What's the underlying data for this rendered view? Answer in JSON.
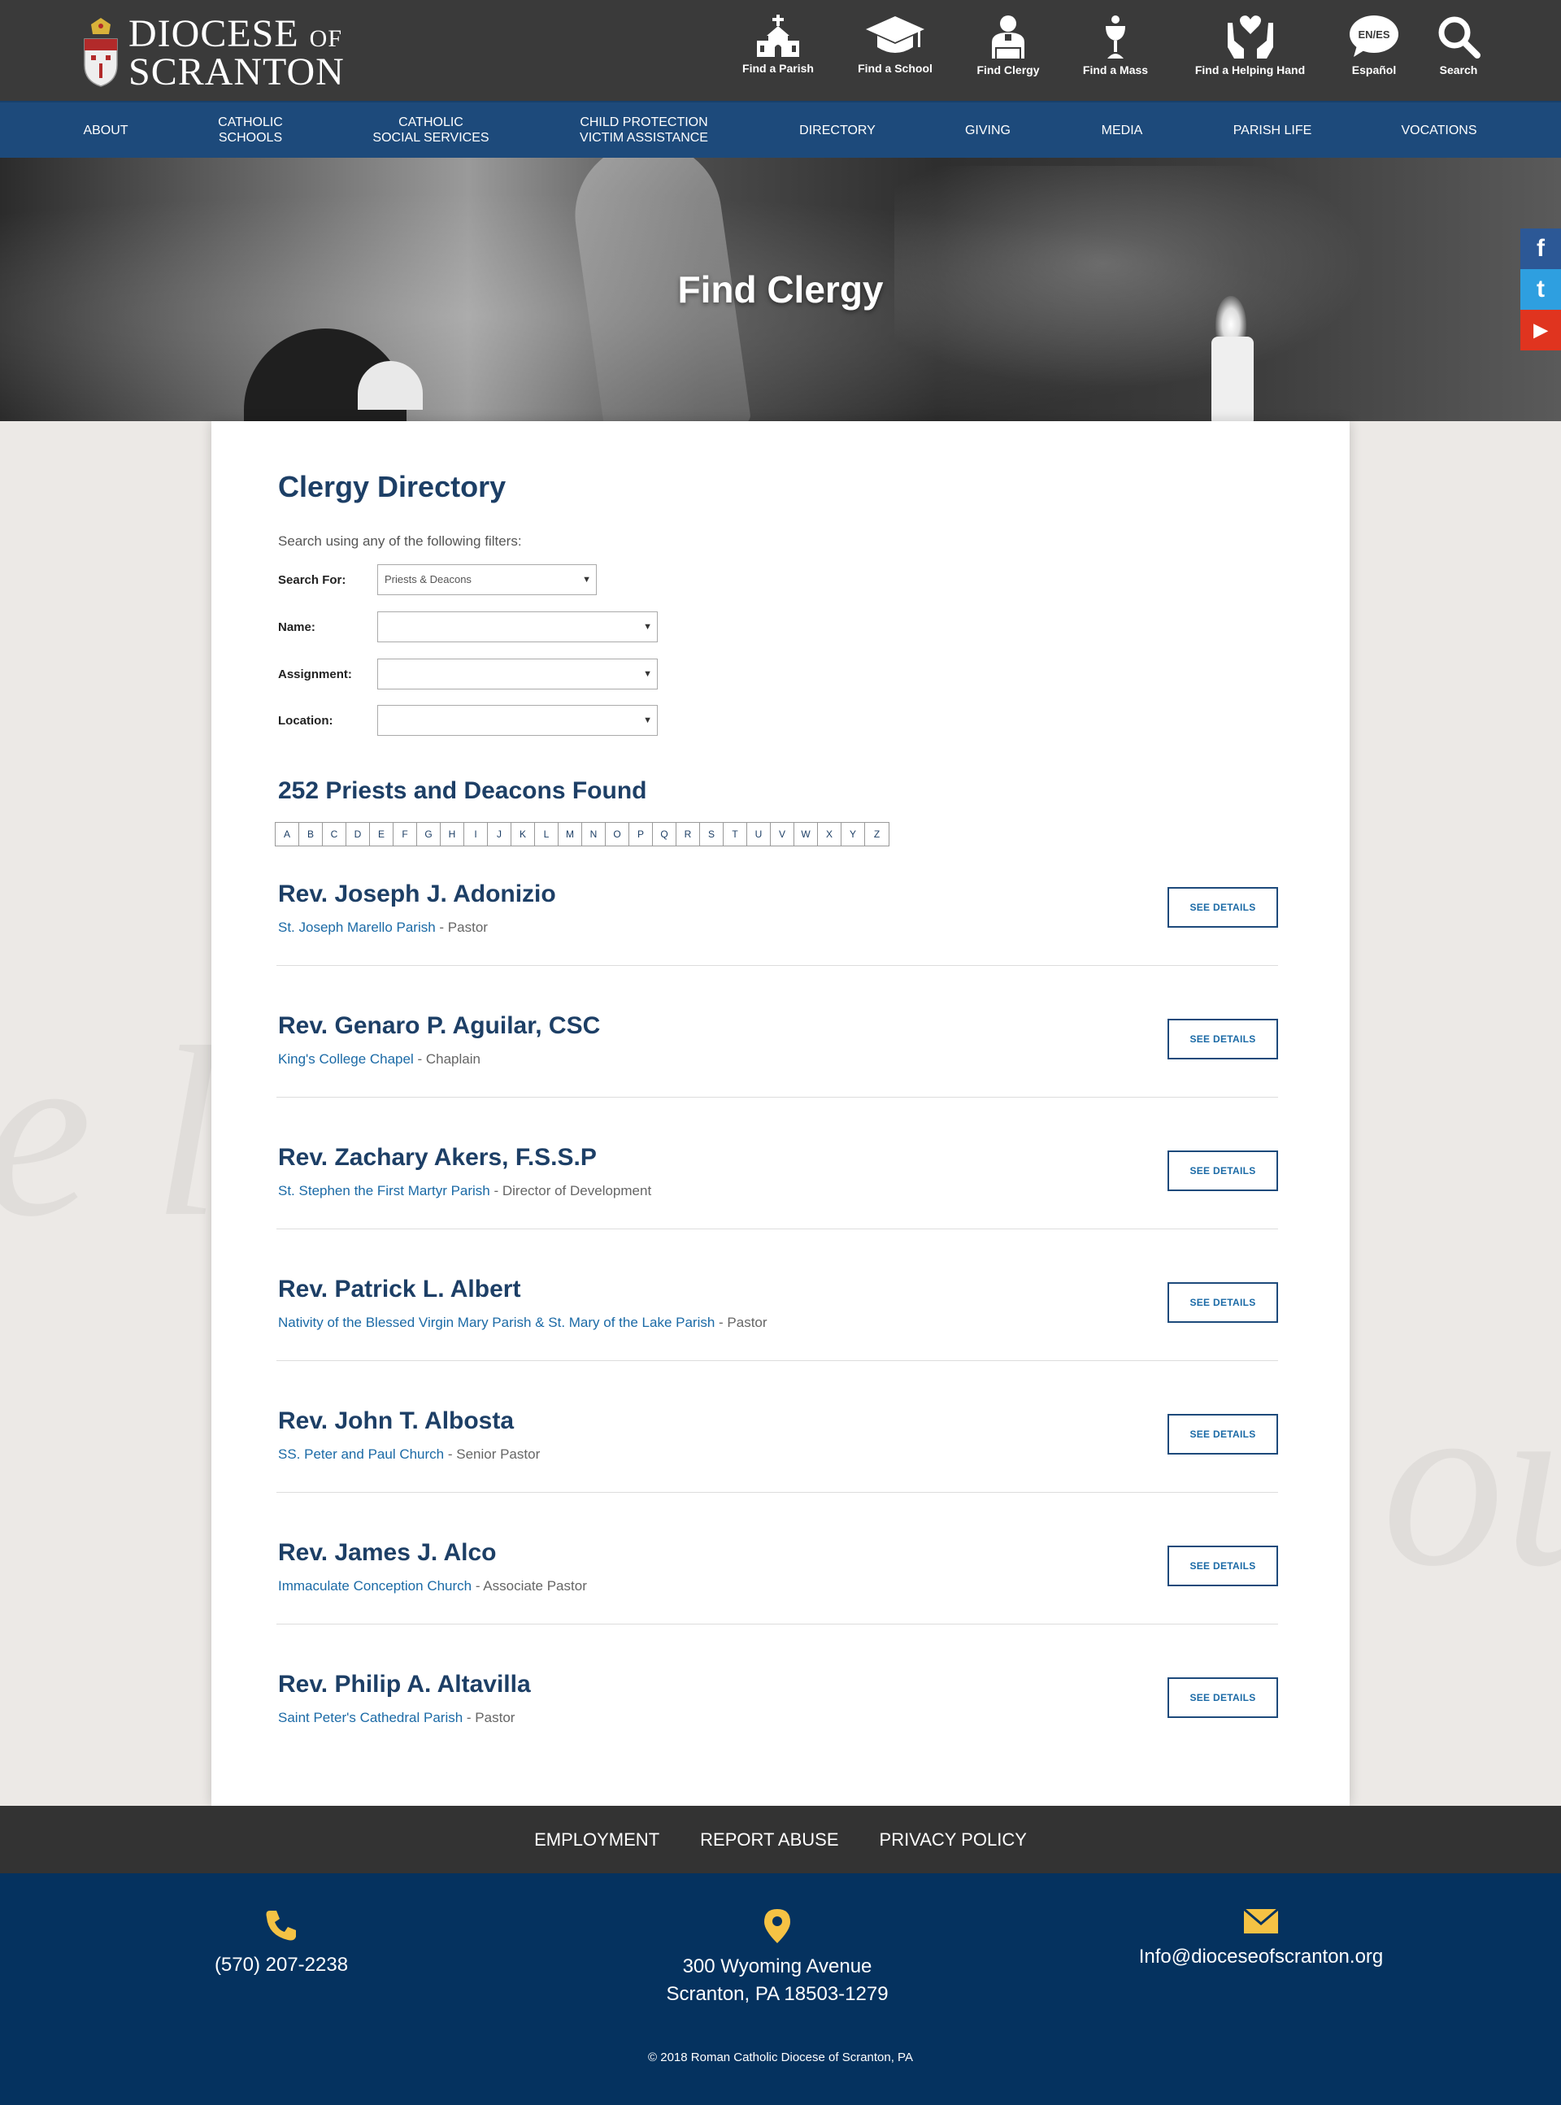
{
  "site": {
    "logo_line1": "DIOCESE",
    "logo_of": "OF",
    "logo_line2": "SCRANTON"
  },
  "quick_nav": [
    {
      "label": "Find a Parish",
      "icon": "church-icon"
    },
    {
      "label": "Find a School",
      "icon": "graduation-cap-icon"
    },
    {
      "label": "Find Clergy",
      "icon": "priest-icon"
    },
    {
      "label": "Find a Mass",
      "icon": "chalice-icon"
    },
    {
      "label": "Find a Helping Hand",
      "icon": "helping-hands-icon"
    },
    {
      "label": "Español",
      "icon": "language-bubble-icon",
      "badge": "EN/ES"
    },
    {
      "label": "Search",
      "icon": "search-icon"
    }
  ],
  "main_nav": [
    "ABOUT",
    "CATHOLIC\nSCHOOLS",
    "CATHOLIC\nSOCIAL SERVICES",
    "CHILD PROTECTION\nVICTIM ASSISTANCE",
    "DIRECTORY",
    "GIVING",
    "MEDIA",
    "PARISH LIFE",
    "VOCATIONS"
  ],
  "hero": {
    "title": "Find Clergy"
  },
  "social": [
    "f",
    "t",
    "▶"
  ],
  "directory": {
    "title": "Clergy Directory",
    "intro": "Search using any of the following filters:",
    "filters": {
      "search_for": {
        "label": "Search For:",
        "value": "Priests & Deacons"
      },
      "name": {
        "label": "Name:",
        "value": ""
      },
      "assignment": {
        "label": "Assignment:",
        "value": ""
      },
      "location": {
        "label": "Location:",
        "value": ""
      }
    },
    "count_text": "252 Priests and Deacons Found",
    "letters": [
      "A",
      "B",
      "C",
      "D",
      "E",
      "F",
      "G",
      "H",
      "I",
      "J",
      "K",
      "L",
      "M",
      "N",
      "O",
      "P",
      "Q",
      "R",
      "S",
      "T",
      "U",
      "V",
      "W",
      "X",
      "Y",
      "Z"
    ],
    "button_label": "SEE DETAILS",
    "entries": [
      {
        "name": "Rev. Joseph J. Adonizio",
        "place": "St. Joseph Marello Parish",
        "role": " - Pastor"
      },
      {
        "name": "Rev. Genaro P. Aguilar, CSC",
        "place": "King's College Chapel ",
        "role": " - Chaplain"
      },
      {
        "name": "Rev. Zachary Akers, F.S.S.P",
        "place": "St. Stephen the First Martyr Parish",
        "role": " - Director of Development"
      },
      {
        "name": "Rev. Patrick L. Albert",
        "place": "Nativity of the Blessed Virgin Mary Parish & St. Mary of the Lake Parish",
        "role": " - Pastor"
      },
      {
        "name": "Rev. John T. Albosta",
        "place": "SS. Peter and Paul Church",
        "role": " - Senior Pastor"
      },
      {
        "name": "Rev. James J. Alco",
        "place": "Immaculate Conception Church",
        "role": " - Associate Pastor"
      },
      {
        "name": "Rev. Philip A. Altavilla",
        "place": "Saint Peter's Cathedral Parish",
        "role": " - Pastor"
      }
    ]
  },
  "footer_links": [
    "EMPLOYMENT",
    "REPORT ABUSE",
    "PRIVACY POLICY"
  ],
  "contact": {
    "phone": "(570) 207-2238",
    "address_line1": "300 Wyoming Avenue",
    "address_line2": "Scranton, PA 18503-1279",
    "email": "Info@dioceseofscranton.org"
  },
  "copyright": "© 2018 Roman Catholic Diocese of Scranton, PA",
  "colors": {
    "header_bg": "#3a3a3a",
    "nav_bg": "#1d4a7b",
    "title_blue": "#1d3f66",
    "link_blue": "#1b6aa6",
    "footer_bg": "#05325f",
    "footer_icon": "#f5c244"
  }
}
